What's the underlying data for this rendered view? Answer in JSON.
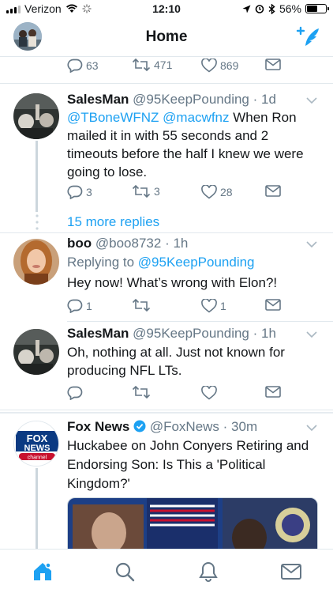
{
  "status_bar": {
    "carrier": "Verizon",
    "time": "12:10",
    "battery": "56%",
    "battery_level": 0.56
  },
  "header": {
    "title": "Home"
  },
  "tweets": [
    {
      "actions": {
        "replies": "63",
        "retweets": "471",
        "likes": "869"
      }
    },
    {
      "name": "SalesMan",
      "handle": "@95KeepPounding",
      "time": "· 1d",
      "mention1": "@TBoneWFNZ",
      "mention2": "@macwfnz",
      "text_rest": " When Ron mailed it in with 55 seconds and 2 timeouts before the half I knew we were going to lose.",
      "actions": {
        "replies": "3",
        "retweets": "3",
        "likes": "28"
      }
    },
    {
      "more_replies": "15 more replies"
    },
    {
      "name": "boo",
      "handle": "@boo8732",
      "time": "· 1h",
      "replying_label": "Replying to",
      "replying_handle": "@95KeepPounding",
      "text": "Hey now! What’s wrong with Elon?!",
      "actions": {
        "replies": "1",
        "retweets": "",
        "likes": "1"
      }
    },
    {
      "name": "SalesMan",
      "handle": "@95KeepPounding",
      "time": "· 1h",
      "text": "Oh, nothing at all. Just not known for producing NFL LTs.",
      "actions": {
        "replies": "",
        "retweets": "",
        "likes": ""
      }
    },
    {
      "name": "Fox News",
      "handle": "@FoxNews",
      "time": "· 30m",
      "verified": true,
      "text": "Huckabee on John Conyers Retiring and Endorsing Son: Is This a 'Political Kingdom?'",
      "avatar_text_top": "FOX",
      "avatar_text_mid": "NEWS",
      "avatar_text_bottom": "channel"
    }
  ],
  "tabs": [
    "home-icon",
    "search-icon",
    "notifications-icon",
    "messages-icon"
  ],
  "colors": {
    "accent": "#1da1f2",
    "muted": "#657786",
    "divider": "#e1e8ed",
    "fox_red": "#c8102e"
  }
}
